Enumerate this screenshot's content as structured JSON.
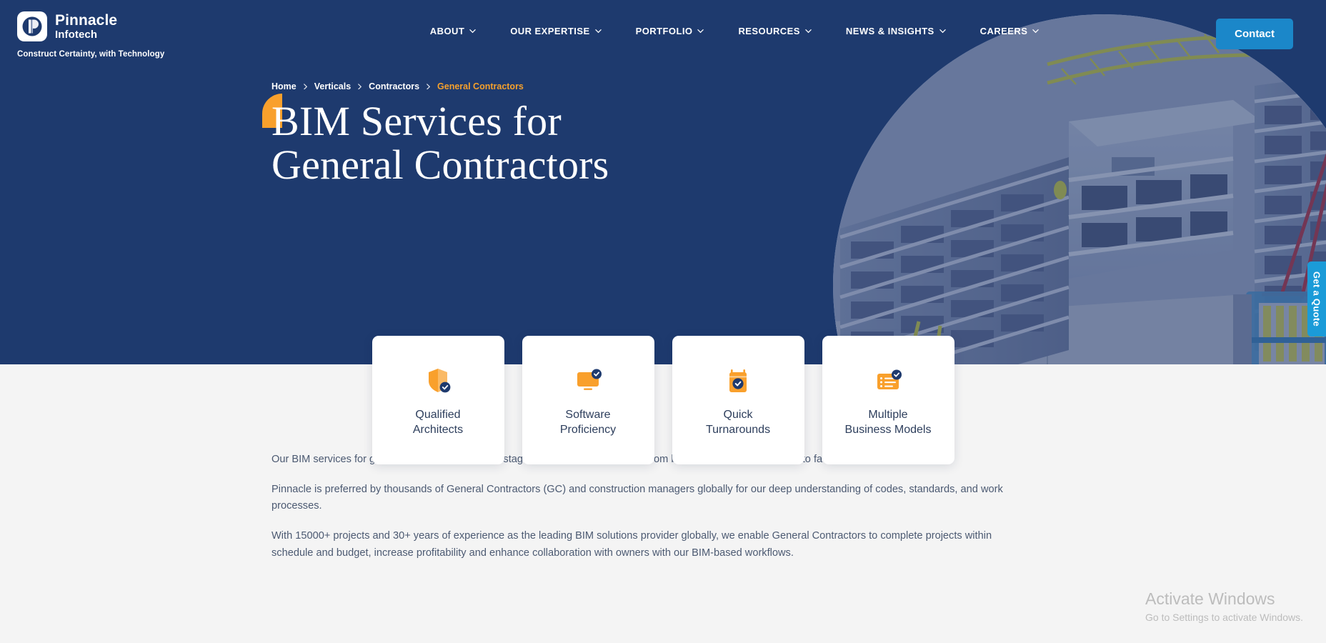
{
  "brand": {
    "logo_icon": "pinnacle-p-logo",
    "name_line1": "Pinnacle",
    "name_line2": "Infotech",
    "tagline": "Construct Certainty, with Technology"
  },
  "colors": {
    "navy": "#1e3a6e",
    "orange": "#f9a02c",
    "button_blue": "#1b87c9",
    "quote_blue": "#1b9bd8",
    "page_bg": "#f4f4f4",
    "body_text": "#4c5a72"
  },
  "nav": {
    "items": [
      {
        "label": "ABOUT",
        "caret": "chevron-down-icon"
      },
      {
        "label": "OUR EXPERTISE",
        "caret": "chevron-down-icon"
      },
      {
        "label": "PORTFOLIO",
        "caret": "chevron-down-icon"
      },
      {
        "label": "RESOURCES",
        "caret": "chevron-down-icon"
      },
      {
        "label": "NEWS & INSIGHTS",
        "caret": "chevron-down-icon"
      },
      {
        "label": "CAREERS",
        "caret": "chevron-down-icon"
      }
    ],
    "contact_label": "Contact"
  },
  "breadcrumb": {
    "items": [
      {
        "label": "Home",
        "current": false
      },
      {
        "label": "Verticals",
        "current": false
      },
      {
        "label": "Contractors",
        "current": false
      },
      {
        "label": "General Contractors",
        "current": true
      }
    ],
    "separator_icon": "chevron-right-icon"
  },
  "hero": {
    "title_line1": "BIM Services for",
    "title_line2": "General Contractors",
    "image_alt": "bim-construction-render"
  },
  "quote_tab": {
    "label": "Get a Quote"
  },
  "feature_cards": [
    {
      "icon": "shield-check-icon",
      "line1": "Qualified",
      "line2": "Architects"
    },
    {
      "icon": "monitor-check-icon",
      "line1": "Software",
      "line2": "Proficiency"
    },
    {
      "icon": "calendar-check-icon",
      "line1": "Quick",
      "line2": "Turnarounds"
    },
    {
      "icon": "list-check-icon",
      "line1": "Multiple",
      "line2": "Business Models"
    }
  ],
  "content": {
    "paragraphs": [
      "Our BIM services for general contractors cover all stages of a project’s lifecycle – from bidding and preconstruction to facility management.",
      "Pinnacle is preferred by thousands of General Contractors (GC) and construction managers globally for our deep understanding of codes, standards, and work processes.",
      "With 15000+ projects and 30+ years of experience as the leading BIM solutions provider globally, we enable General Contractors to complete projects within schedule and budget, increase profitability and enhance collaboration with owners with our BIM-based workflows."
    ]
  },
  "watermark": {
    "line1": "Activate Windows",
    "line2": "Go to Settings to activate Windows."
  }
}
